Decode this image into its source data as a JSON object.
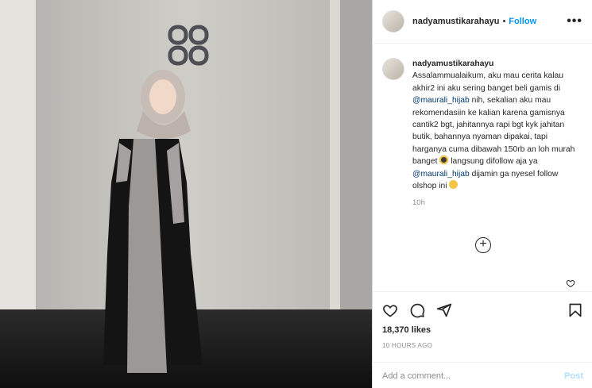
{
  "post": {
    "username": "nadyamustikarahayu",
    "follow_label": "Follow",
    "separator": "•",
    "more_label": "•••"
  },
  "caption": {
    "username": "nadyamustikarahayu",
    "text_1": "Assalammualaikum, aku mau cerita kalau akhir2 ini aku sering banget beli gamis di ",
    "mention_1": "@maurali_hijab",
    "text_2": " nih, sekalian aku mau rekomendasiin ke kalian karena gamisnya cantik2 bgt, jahitannya rapi bgt kyk jahitan butik, bahannya nyaman dipakai, tapi harganya cuma dibawah 150rb an loh murah banget ",
    "text_3": " langsung difollow aja ya ",
    "mention_2": "@maurali_hijab",
    "text_4": " dijamin ga nyesel follow olshop ini ",
    "time": "10h"
  },
  "load_more_label": "+",
  "stats": {
    "likes": "18,370 likes",
    "posted_ago": "10 HOURS AGO"
  },
  "comment": {
    "placeholder": "Add a comment...",
    "post_label": "Post"
  },
  "icons": [
    "heart-icon",
    "comment-icon",
    "share-icon",
    "bookmark-icon",
    "plus-circle-icon",
    "more-icon"
  ],
  "colors": {
    "accent": "#0095f6",
    "post_disabled": "#b2dffc",
    "text": "#262626",
    "muted": "#8e8e8e"
  }
}
